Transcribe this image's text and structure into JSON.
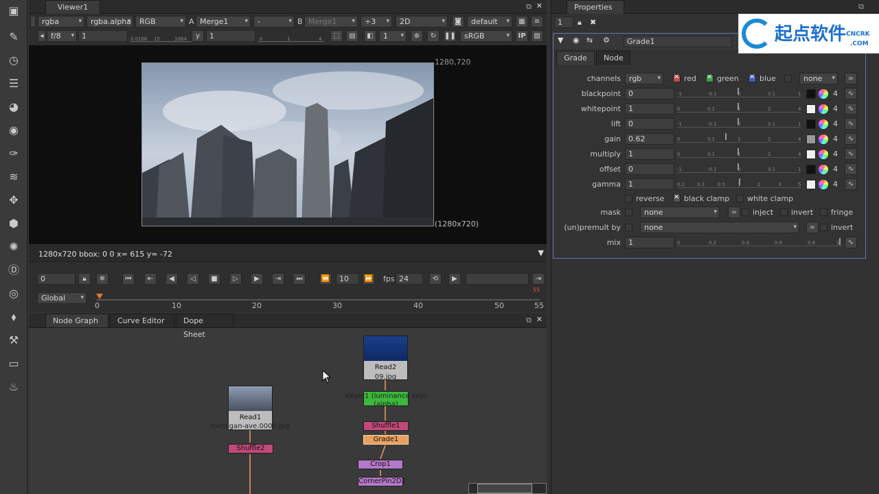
{
  "viewer": {
    "tab": "Viewer1",
    "row1": {
      "channel_layer": "rgba",
      "alpha_channel": "rgba.alpha",
      "display_channels": "RGB",
      "a_label": "A",
      "a_input": "Merge1",
      "op": "-",
      "b_label": "B",
      "b_input": "Merge1",
      "proxy": "÷3",
      "mode": "2D",
      "lut": "default"
    },
    "row2": {
      "fstop": "f/8",
      "gain_value": "1",
      "gain_ticks": [
        "0.0166",
        "15",
        "1064"
      ],
      "y_label": "y",
      "gamma_value": "1",
      "gamma_ticks": [
        "0",
        "1",
        "4"
      ],
      "frame_select": "1",
      "colorspace": "sRGB",
      "ip": "IP"
    },
    "format_top": "1280,720",
    "format_bottom": "(1280x720)",
    "info": "1280x720 bbox: 0 0  x= 615 y= -72"
  },
  "transport": {
    "frame": "0",
    "increment": "10",
    "fps_label": "fps",
    "fps": "24",
    "range_mode": "Global",
    "ticks": [
      "0",
      "10",
      "20",
      "30",
      "40",
      "50",
      "55"
    ],
    "end_marker": "55"
  },
  "nodegraph": {
    "tabs": [
      "Node Graph",
      "Curve Editor",
      "Dope Sheet"
    ],
    "nodes": {
      "read1": "Read1",
      "read1_file": "michigan-ave.0000.jpg",
      "shuffle2": "Shuffle2",
      "read2": "Read2",
      "read2_file": "09.jpg",
      "keyer1": "Keyer1 (luminance key)",
      "keyer1_sub": "(alpha)",
      "shuffle1": "Shuffle1",
      "grade1": "Grade1",
      "crop1": "Crop1",
      "cornerpin": "CornerPin2D1"
    }
  },
  "properties": {
    "tab": "Properties",
    "count": "1",
    "node_name": "Grade1",
    "tabs": [
      "Grade",
      "Node"
    ],
    "watermark": "起点软件",
    "watermark_sub": "CNCRK",
    "watermark_url": ".COM",
    "channels": {
      "label": "channels",
      "value": "rgb",
      "red": "red",
      "green": "green",
      "blue": "blue",
      "extra": "none",
      "eq": "="
    },
    "knobs": [
      {
        "label": "blackpoint",
        "value": "0",
        "ticks": [
          "-1",
          "-0.1",
          "0",
          "0.1",
          "1"
        ],
        "swatch": "#111111"
      },
      {
        "label": "whitepoint",
        "value": "1",
        "ticks": [
          "0",
          "0.1",
          "1",
          "2",
          "4"
        ],
        "swatch": "#f0f0f0"
      },
      {
        "label": "lift",
        "value": "0",
        "ticks": [
          "-1",
          "-0.1",
          "0",
          "0.1",
          "1"
        ],
        "swatch": "#111111"
      },
      {
        "label": "gain",
        "value": "0.62",
        "ticks": [
          "0",
          "0.1",
          "1",
          "2",
          "4"
        ],
        "swatch": "#9a9a9a"
      },
      {
        "label": "multiply",
        "value": "1",
        "ticks": [
          "0",
          "0.1",
          "1",
          "2",
          "4"
        ],
        "swatch": "#f0f0f0"
      },
      {
        "label": "offset",
        "value": "0",
        "ticks": [
          "-1",
          "-0.1",
          "0",
          "0.1",
          "1"
        ],
        "swatch": "#111111"
      },
      {
        "label": "gamma",
        "value": "1",
        "ticks": [
          "0.2",
          "0.3",
          "0.5",
          "1",
          "2",
          "3",
          "5"
        ],
        "swatch": "#f0f0f0"
      }
    ],
    "four": "4",
    "reverse": "reverse",
    "black_clamp": "black clamp",
    "white_clamp": "white clamp",
    "mask": {
      "label": "mask",
      "value": "none",
      "eq": "=",
      "inject": "inject",
      "invert": "invert",
      "fringe": "fringe"
    },
    "premult": {
      "label": "(un)premult by",
      "value": "none",
      "eq": "=",
      "invert": "invert"
    },
    "mix": {
      "label": "mix",
      "value": "1",
      "ticks": [
        "0",
        "0.2",
        "0.4",
        "0.6",
        "0.8",
        "1"
      ]
    }
  }
}
